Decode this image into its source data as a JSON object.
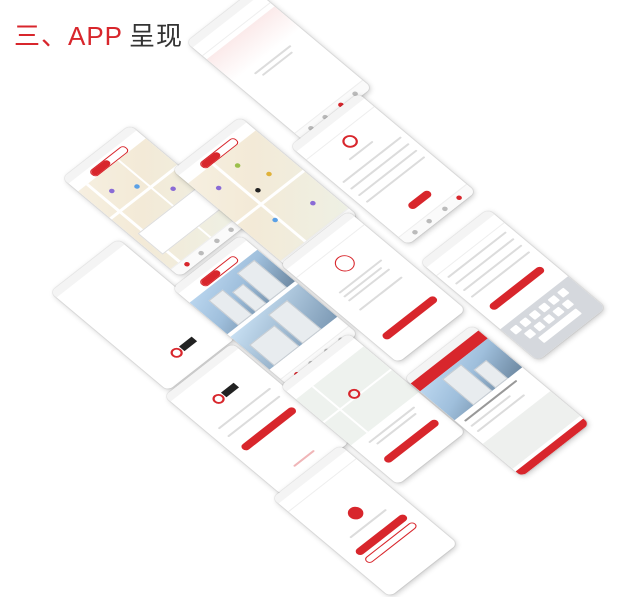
{
  "heading": {
    "section_label": "三、APP",
    "title_label": "呈现"
  },
  "screens": [
    {
      "id": "loading"
    },
    {
      "id": "profile"
    },
    {
      "id": "map-list"
    },
    {
      "id": "map-markers"
    },
    {
      "id": "blank-splash"
    },
    {
      "id": "photo-list"
    },
    {
      "id": "notice"
    },
    {
      "id": "form-keyboard"
    },
    {
      "id": "login"
    },
    {
      "id": "map-pin"
    },
    {
      "id": "detail"
    },
    {
      "id": "confirm"
    }
  ],
  "colors": {
    "brand_red": "#d8262c",
    "map_beige": "#f3ead7",
    "heading_dark": "#333333"
  }
}
